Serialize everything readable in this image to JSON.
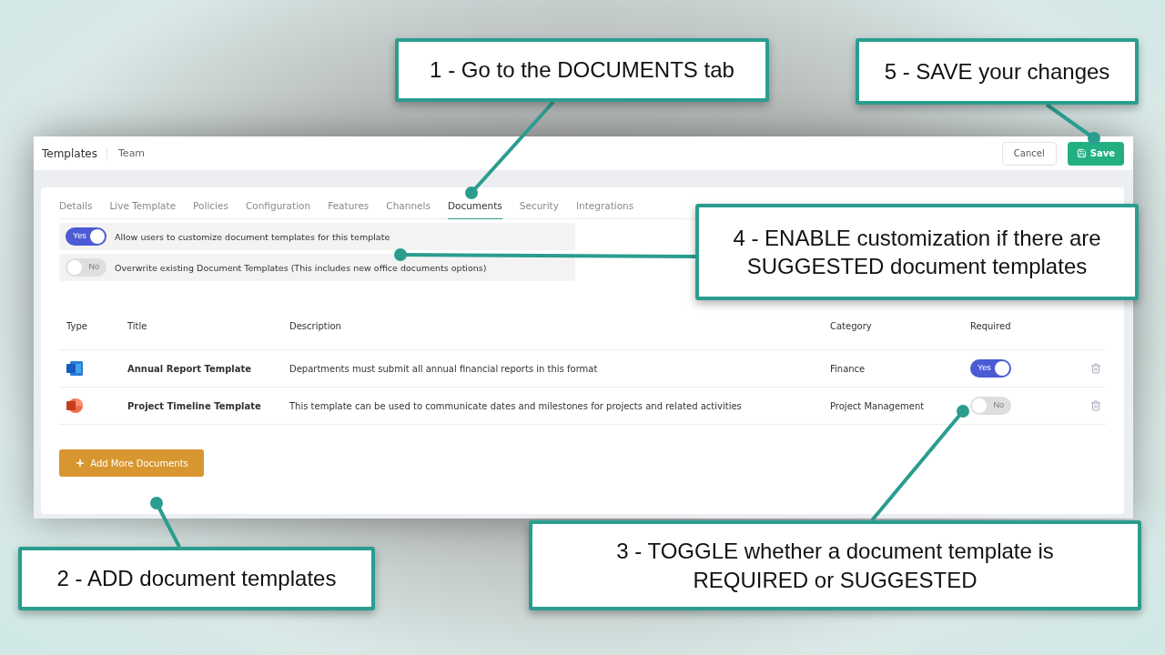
{
  "header": {
    "title": "Templates",
    "subtitle": "Team",
    "cancel": "Cancel",
    "save": "Save"
  },
  "tabs": [
    {
      "label": "Details",
      "selected": false
    },
    {
      "label": "Live Template",
      "selected": false
    },
    {
      "label": "Policies",
      "selected": false
    },
    {
      "label": "Configuration",
      "selected": false
    },
    {
      "label": "Features",
      "selected": false
    },
    {
      "label": "Channels",
      "selected": false
    },
    {
      "label": "Documents",
      "selected": true
    },
    {
      "label": "Security",
      "selected": false
    },
    {
      "label": "Integrations",
      "selected": false
    }
  ],
  "settings": [
    {
      "label": "Allow users to customize document templates for this template",
      "on": true,
      "toggle_text": "Yes"
    },
    {
      "label": "Overwrite existing Document Templates (This includes new office documents options)",
      "on": false,
      "toggle_text": "No"
    }
  ],
  "table": {
    "columns": [
      "Type",
      "Title",
      "Description",
      "Category",
      "Required"
    ],
    "rows": [
      {
        "kind": "word",
        "title": "Annual Report Template",
        "description": "Departments must submit all annual financial reports in this format",
        "category": "Finance",
        "required": true,
        "toggle_text": "Yes"
      },
      {
        "kind": "powerpoint",
        "title": "Project Timeline Template",
        "description": "This template can be used to communicate dates and milestones for projects and related activities",
        "category": "Project Management",
        "required": false,
        "toggle_text": "No"
      }
    ]
  },
  "add_button": "Add More Documents",
  "callouts": [
    {
      "text": "1 - Go to the DOCUMENTS tab"
    },
    {
      "text": "5 - SAVE your changes"
    },
    {
      "text": "4 - ENABLE customization if there are SUGGESTED document templates"
    },
    {
      "text": "2 - ADD document templates"
    },
    {
      "text": "3 - TOGGLE whether a document template is REQUIRED or SUGGESTED"
    }
  ]
}
